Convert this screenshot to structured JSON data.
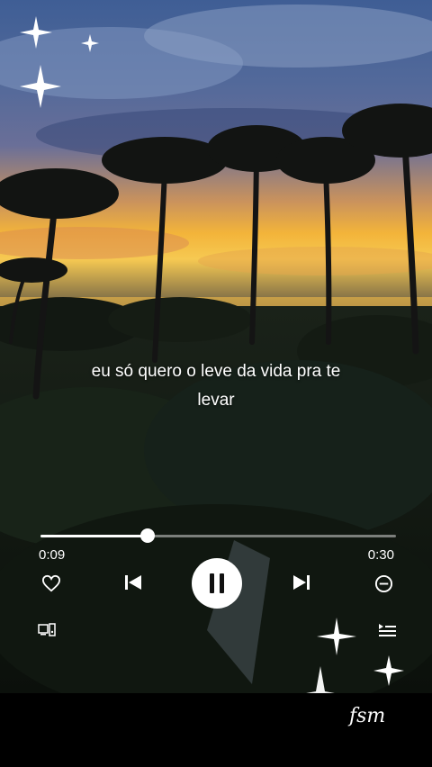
{
  "lyrics": {
    "line1": "eu só quero o leve da vida pra te",
    "line2": "levar"
  },
  "player": {
    "elapsed": "0:09",
    "total": "0:30",
    "progress": 0.3
  },
  "icons": {
    "favorite": "heart-icon",
    "previous": "skip-previous-icon",
    "play_pause": "pause-icon",
    "next": "skip-next-icon",
    "remove": "minus-circle-icon",
    "devices": "connect-device-icon",
    "queue": "queue-list-icon"
  },
  "signature": "fsm",
  "colors": {
    "text": "#ffffff",
    "sky_top": "#4a6a9c",
    "sunset": "#f4b73a"
  }
}
